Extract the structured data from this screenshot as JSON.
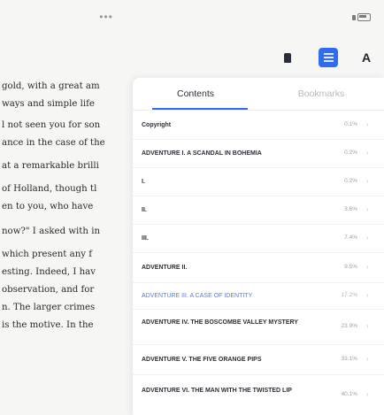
{
  "status": {
    "dots": "•••"
  },
  "toolbar": {
    "font_label": "A"
  },
  "book_lines": [
    "gold, with a great am",
    "ways and simple life",
    "l not seen you for son",
    "ance in the case of the",
    "at a remarkable brilli",
    "of Holland, though tl",
    "en to you, who have",
    "now?\" I asked with in",
    "which present any f",
    "esting. Indeed, I hav",
    "observation, and for",
    "n. The larger crimes",
    "is the motive. In the"
  ],
  "panel": {
    "tabs": [
      "Contents",
      "Bookmarks"
    ],
    "items": [
      {
        "title": "Copyright",
        "pct": "0.1%"
      },
      {
        "title": "ADVENTURE I. A SCANDAL IN BOHEMIA",
        "pct": "0.2%"
      },
      {
        "title": "I.",
        "pct": "0.2%"
      },
      {
        "title": "II.",
        "pct": "3.6%"
      },
      {
        "title": "III.",
        "pct": "7.4%"
      },
      {
        "title": "ADVENTURE II.",
        "pct": "9.5%"
      },
      {
        "title": "ADVENTURE III. A CASE OF IDENTITY",
        "pct": "17.2%"
      },
      {
        "title": "ADVENTURE IV. THE BOSCOMBE VALLEY MYSTERY",
        "pct": "23.9%"
      },
      {
        "title": "ADVENTURE V. THE FIVE ORANGE PIPS",
        "pct": "33.1%"
      },
      {
        "title": "ADVENTURE VI. THE MAN WITH THE TWISTED LIP",
        "pct": "40.1%"
      }
    ]
  }
}
